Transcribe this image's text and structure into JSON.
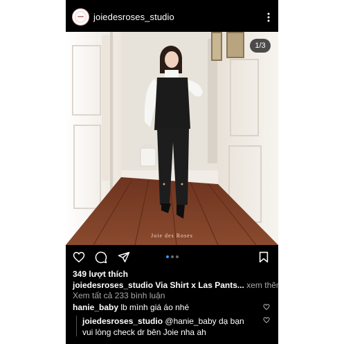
{
  "header": {
    "username": "joiedesroses_studio",
    "more_icon": "more-vertical-icon"
  },
  "photo": {
    "counter": "1/3",
    "watermark": "Joie des Roses",
    "carousel_index": 1,
    "carousel_total": 3
  },
  "actions": {
    "like_icon": "heart-icon",
    "comment_icon": "comment-icon",
    "share_icon": "send-icon",
    "save_icon": "bookmark-icon",
    "accent_color": "#3797f0"
  },
  "post": {
    "likes": "349 lượt thích",
    "caption_user": "joiedesroses_studio",
    "caption_text": "Via Shirt x Las Pants...",
    "caption_more": "xem thêm",
    "view_comments": "Xem tất cả 233 bình luận"
  },
  "comments": [
    {
      "user": "hanie_baby",
      "text": "lb mình giá áo nhé"
    }
  ],
  "reply": {
    "user": "joiedesroses_studio",
    "text": "@hanie_baby dạ bạn vui lòng check dr bên Joie nha ah"
  }
}
